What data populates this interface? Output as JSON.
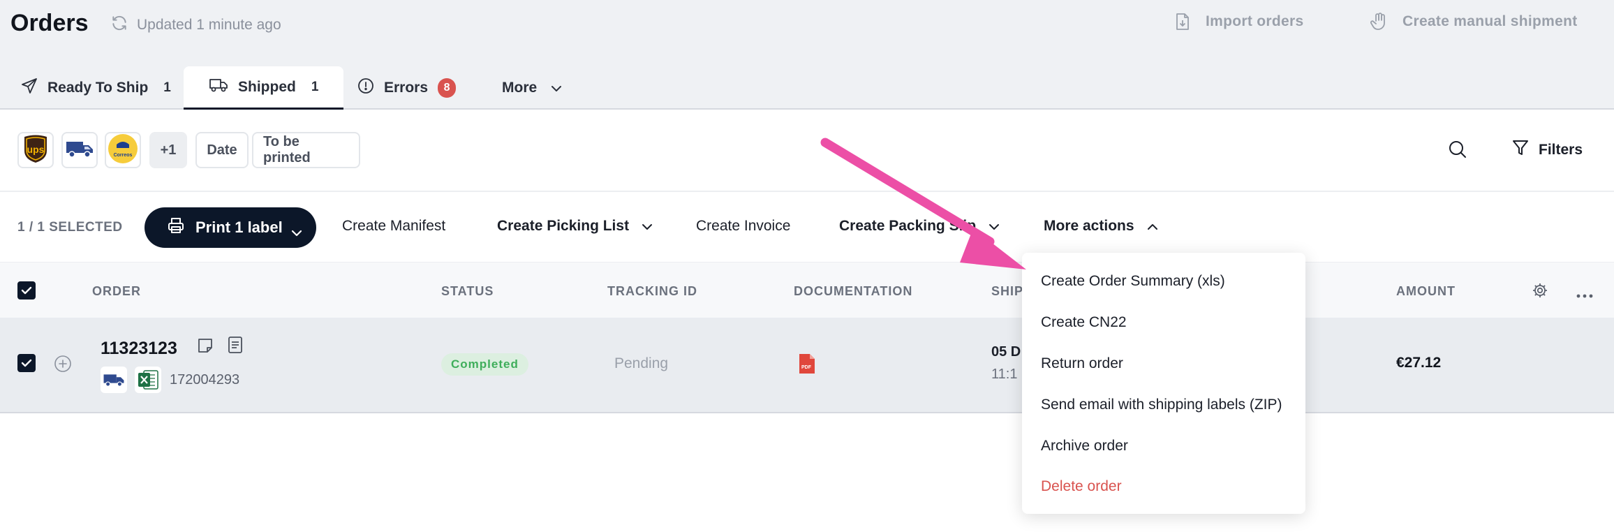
{
  "header": {
    "title": "Orders",
    "updated": "Updated 1 minute ago",
    "import_orders": "Import orders",
    "create_manual_shipment": "Create manual shipment"
  },
  "tabs": [
    {
      "label": "Ready To Ship",
      "count": "1",
      "icon": "send-icon"
    },
    {
      "label": "Shipped",
      "count": "1",
      "icon": "truck-icon",
      "active": true
    },
    {
      "label": "Errors",
      "count": "8",
      "icon": "alert-circle-icon"
    },
    {
      "label": "More",
      "icon": "chevron-down-icon"
    }
  ],
  "filters": {
    "carriers": [
      "UPS",
      "",
      "Correos"
    ],
    "more_carriers": "+1",
    "date_chip": "Date",
    "to_be_printed_chip": "To be printed",
    "filters_label": "Filters"
  },
  "actions": {
    "selected": "1 / 1 SELECTED",
    "print_label": "Print 1 label",
    "create_manifest": "Create Manifest",
    "create_picking_list": "Create Picking List",
    "create_invoice": "Create Invoice",
    "create_packing_slip": "Create Packing Slip",
    "more_actions": "More actions"
  },
  "table": {
    "columns": [
      "ORDER",
      "STATUS",
      "TRACKING ID",
      "DOCUMENTATION",
      "SHIP",
      "AMOUNT"
    ],
    "rows": [
      {
        "order": "11323123",
        "sub_id": "172004293",
        "status": "Completed",
        "tracking": "Pending",
        "doc_label": "PDF",
        "ship_date": "05 D",
        "ship_time": "11:1",
        "amount": "€27.12"
      }
    ]
  },
  "more_actions_menu": {
    "items": [
      "Create Order Summary (xls)",
      "Create CN22",
      "Return order",
      "Send email with shipping labels (ZIP)",
      "Archive order",
      "Delete order"
    ]
  },
  "colors": {
    "accent_dark": "#0c1729",
    "danger": "#d9534f",
    "success": "#3fae5b",
    "arrow": "#ec4fa6"
  }
}
